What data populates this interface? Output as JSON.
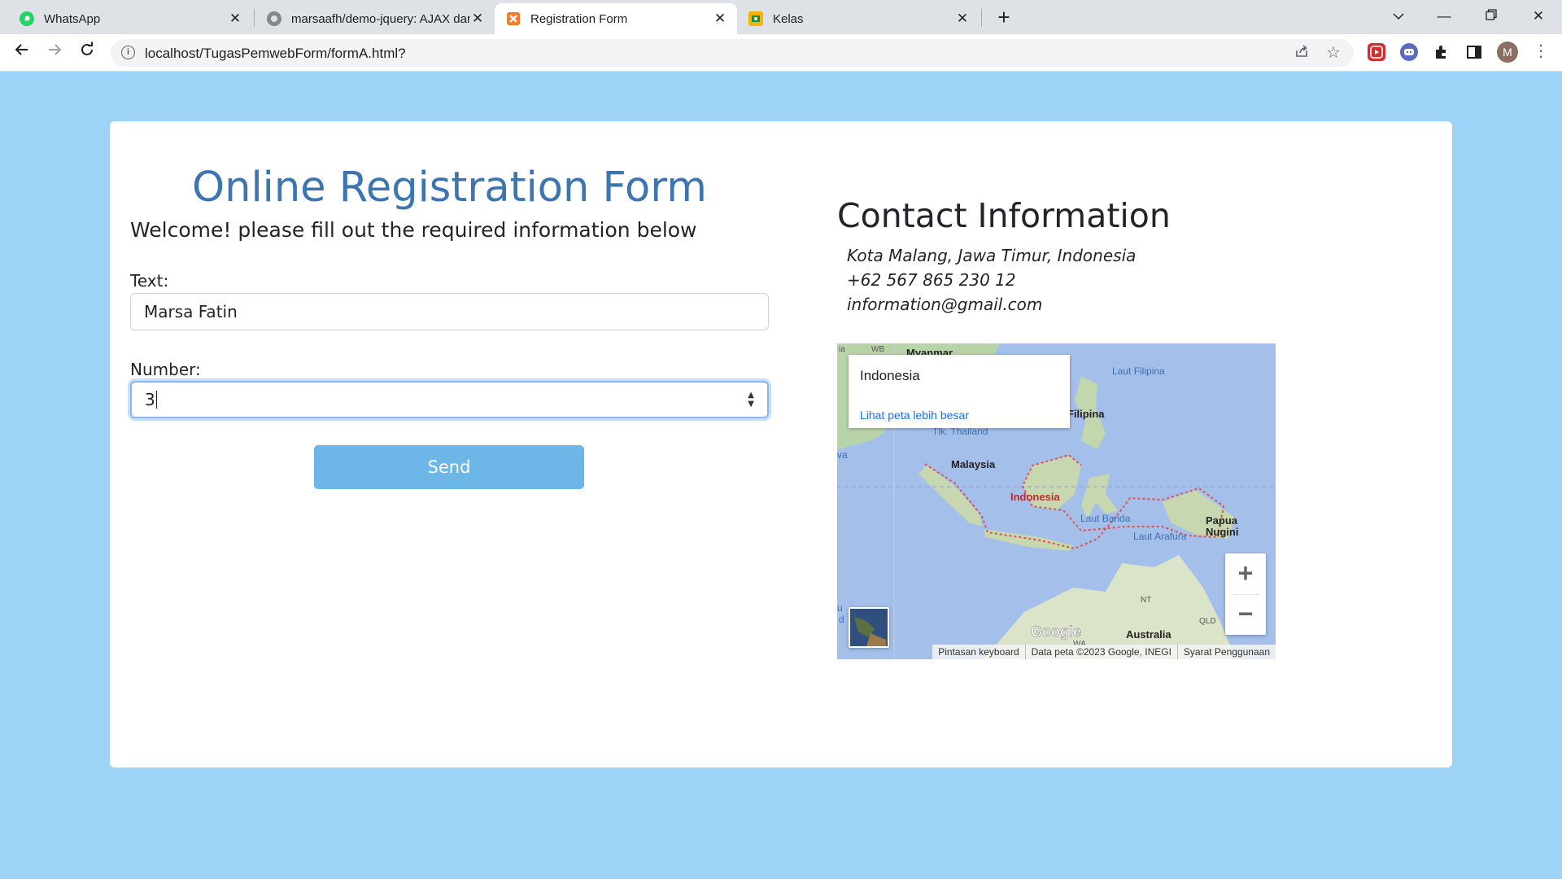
{
  "browser": {
    "tabs": [
      {
        "title": "WhatsApp",
        "icon": "whatsapp-icon",
        "active": false
      },
      {
        "title": "marsaafh/demo-jquery: AJAX dan",
        "icon": "github-icon",
        "active": false
      },
      {
        "title": "Registration Form",
        "icon": "xampp-icon",
        "active": true
      },
      {
        "title": "Kelas",
        "icon": "classroom-icon",
        "active": false
      }
    ],
    "url": "localhost/TugasPemwebForm/formA.html?",
    "profile_initial": "M"
  },
  "form": {
    "title": "Online Registration Form",
    "welcome": "Welcome! please fill out the required information below",
    "text_label": "Text:",
    "text_value": "Marsa Fatin",
    "number_label": "Number:",
    "number_value": "3",
    "send_label": "Send"
  },
  "contact": {
    "title": "Contact Information",
    "address": "Kota Malang, Jawa Timur, Indonesia",
    "phone": "+62 567 865 230 12",
    "email": "information@gmail.com"
  },
  "map": {
    "info_name": "Indonesia",
    "info_link": "Lihat peta lebih besar",
    "labels": {
      "myanmar": "Myanmar",
      "wb": "WB",
      "ia": "ia",
      "va": "va",
      "laut_filipina": "Laut Filipina",
      "filipina": "Filipina",
      "tlk_thailand": "Tlk. Thailand",
      "malaysia": "Malaysia",
      "indonesia": "Indonesia",
      "laut_banda": "Laut Banda",
      "papua": "Papua",
      "nugini": "Nugini",
      "laut_arafura": "Laut Arafura",
      "nt": "NT",
      "qld": "QLD",
      "wa": "WA",
      "australia": "Australia",
      "u": "u",
      "d": "d"
    },
    "zoom_in": "+",
    "zoom_out": "−",
    "attribution": [
      "Pintasan keyboard",
      "Data peta ©2023 Google, INEGI",
      "Syarat Penggunaan"
    ],
    "google_logo": "Google"
  }
}
